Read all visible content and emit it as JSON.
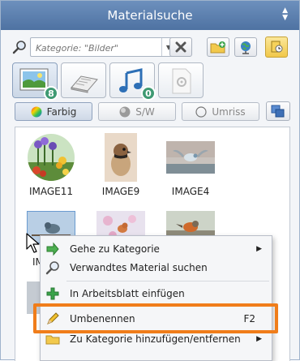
{
  "window": {
    "title": "Materialsuche"
  },
  "search": {
    "placeholder": "Kategorie: \"Bilder\"",
    "value": ""
  },
  "tabs": [
    {
      "name": "images",
      "badge": "8",
      "active": true
    },
    {
      "name": "texts",
      "badge": "",
      "active": false
    },
    {
      "name": "audio",
      "badge": "0",
      "active": false
    },
    {
      "name": "other",
      "badge": "",
      "active": false
    }
  ],
  "filters": {
    "color": "Farbig",
    "bw": "S/W",
    "outline": "Umriss"
  },
  "images": [
    {
      "name": "IMAGE11"
    },
    {
      "name": "IMAGE9"
    },
    {
      "name": "IMAGE4"
    },
    {
      "name": "IMAGE"
    }
  ],
  "context_menu": {
    "items": [
      {
        "label": "Gehe zu Kategorie",
        "submenu": true
      },
      {
        "label": "Verwandtes Material suchen"
      },
      {
        "label": "In Arbeitsblatt einfügen"
      },
      {
        "label": "Umbenennen",
        "shortcut": "F2"
      },
      {
        "label": "Zu Kategorie hinzufügen/entfernen",
        "submenu": true
      }
    ]
  },
  "colors": {
    "accent": "#4e72a2",
    "highlight": "#f07d1a",
    "badge": "#3f9a73"
  }
}
